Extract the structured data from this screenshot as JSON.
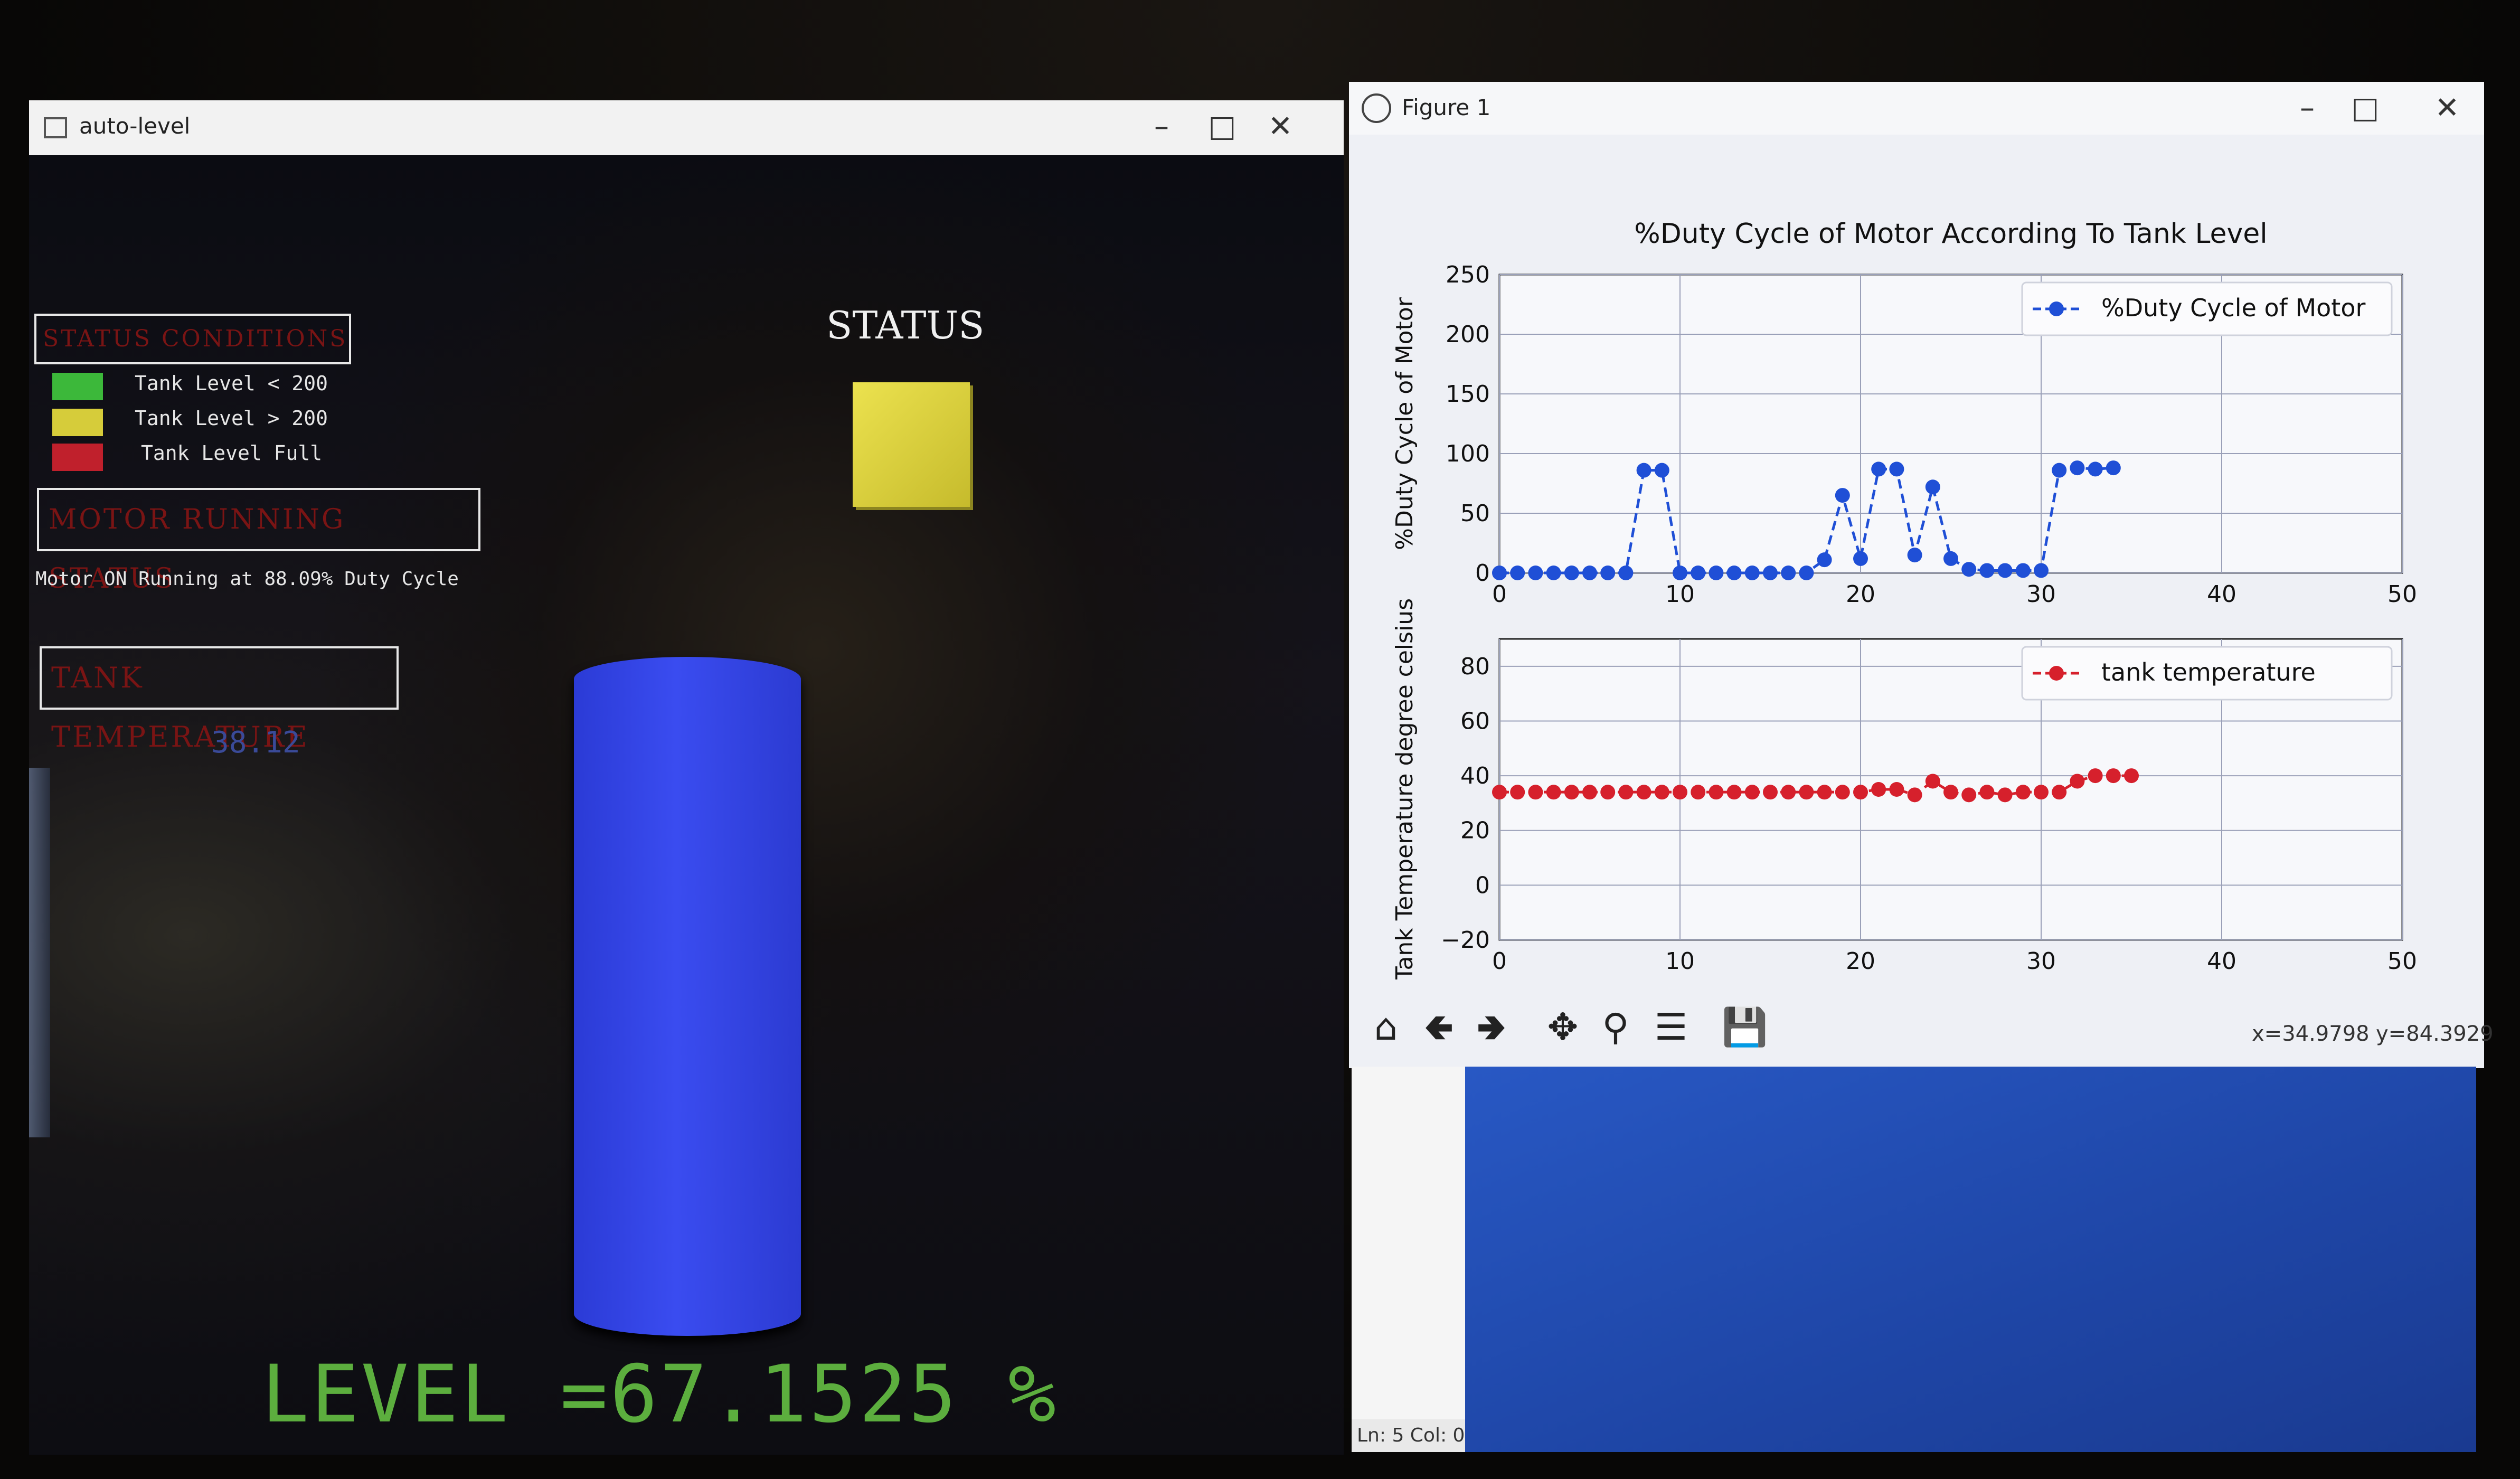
{
  "autolevel": {
    "title": "auto-level",
    "controls": {
      "minimize": "–",
      "maximize": "□",
      "close": "✕"
    },
    "status_conditions": {
      "title": "STATUS CONDITIONS",
      "items": [
        {
          "label": "Tank Level < 200",
          "color": "#3cb83a"
        },
        {
          "label": "Tank Level > 200",
          "color": "#d6cc3a"
        },
        {
          "label": "Tank Level Full",
          "color": "#c0202c"
        }
      ]
    },
    "motor": {
      "title": "MOTOR RUNNING STATUS",
      "text": "Motor ON Running at 88.09% Duty Cycle"
    },
    "temperature": {
      "title": "TANK TEMPERATURE",
      "value": "38.12"
    },
    "status": {
      "title": "STATUS",
      "color": "#e0d642"
    },
    "tank": {
      "color": "#3446e6"
    },
    "level": "LEVEL =67.1525 %"
  },
  "figure": {
    "title": "Figure 1",
    "controls": {
      "minimize": "–",
      "maximize": "□",
      "close": "✕"
    },
    "toolbar_icons": [
      "home-icon",
      "back-arrow-icon",
      "forward-arrow-icon",
      "pan-icon",
      "zoom-icon",
      "configure-subplots-icon",
      "save-icon"
    ],
    "coords": {
      "x": "x=34.9798",
      "y": "y=84.3929"
    }
  },
  "editor": {
    "status": "Ln: 5  Col: 0"
  },
  "chart_data": [
    {
      "type": "line",
      "title": "%Duty Cycle of Motor According To Tank Level",
      "xlabel": "",
      "ylabel": "%Duty Cycle of Motor",
      "xlim": [
        0,
        50
      ],
      "ylim": [
        0,
        250
      ],
      "xticks": [
        0,
        10,
        20,
        30,
        40,
        50
      ],
      "yticks": [
        0,
        50,
        100,
        150,
        200,
        250
      ],
      "grid": true,
      "legend": "top-right",
      "series": [
        {
          "name": "%Duty Cycle of Motor",
          "color": "#1f4fd6",
          "linestyle": "dashed",
          "marker": "o",
          "x": [
            0,
            1,
            2,
            3,
            4,
            5,
            6,
            7,
            8,
            9,
            10,
            11,
            12,
            13,
            14,
            15,
            16,
            17,
            18,
            19,
            20,
            21,
            22,
            23,
            24,
            25,
            26,
            27,
            28,
            29,
            30,
            31,
            32,
            33,
            34
          ],
          "y": [
            0,
            0,
            0,
            0,
            0,
            0,
            0,
            0,
            86,
            86,
            0,
            0,
            0,
            0,
            0,
            0,
            0,
            0,
            11,
            65,
            12,
            87,
            87,
            15,
            72,
            12,
            3,
            2,
            2,
            2,
            2,
            86,
            88,
            87,
            88
          ]
        }
      ]
    },
    {
      "type": "line",
      "title": "",
      "xlabel": "",
      "ylabel": "Tank Temperature degree celsius",
      "xlim": [
        0,
        50
      ],
      "ylim": [
        -20,
        90
      ],
      "xticks": [
        0,
        10,
        20,
        30,
        40,
        50
      ],
      "yticks": [
        -20,
        0,
        20,
        40,
        60,
        80
      ],
      "grid": true,
      "legend": "top-right",
      "series": [
        {
          "name": "tank temperature",
          "color": "#d6202c",
          "linestyle": "dashed",
          "marker": "o",
          "x": [
            0,
            1,
            2,
            3,
            4,
            5,
            6,
            7,
            8,
            9,
            10,
            11,
            12,
            13,
            14,
            15,
            16,
            17,
            18,
            19,
            20,
            21,
            22,
            23,
            24,
            25,
            26,
            27,
            28,
            29,
            30,
            31,
            32,
            33,
            34,
            35
          ],
          "y": [
            34,
            34,
            34,
            34,
            34,
            34,
            34,
            34,
            34,
            34,
            34,
            34,
            34,
            34,
            34,
            34,
            34,
            34,
            34,
            34,
            34,
            35,
            35,
            33,
            38,
            34,
            33,
            34,
            33,
            34,
            34,
            34,
            38,
            40,
            40,
            40
          ]
        }
      ]
    }
  ]
}
